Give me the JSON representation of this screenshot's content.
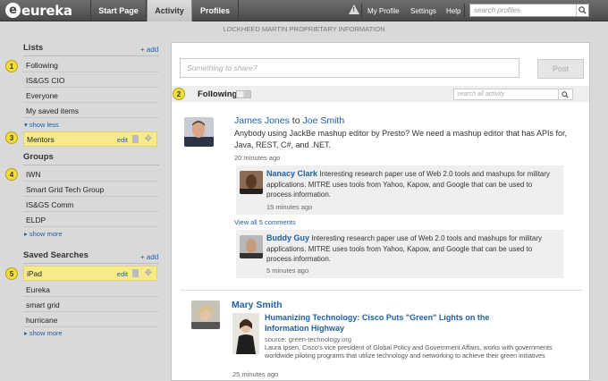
{
  "app": {
    "logo_text": "eureka",
    "logo_letter": "e",
    "banner": "LOCKHEED MARTIN PROPRIETARY INFORMATION"
  },
  "nav": {
    "tabs": [
      "Start Page",
      "Activity",
      "Profiles"
    ],
    "my_profile": "My Profile",
    "settings": "Settings",
    "help": "Help",
    "search_placeholder": "search profiles"
  },
  "sidebar": {
    "lists": {
      "title": "Lists",
      "add": "+ add",
      "items": [
        "Following",
        "IS&GS CIO",
        "Everyone",
        "My saved items"
      ],
      "show_less": "show less",
      "highlighted": "Mentors",
      "edit": "edit"
    },
    "groups": {
      "title": "Groups",
      "items": [
        "IWN",
        "Smart Grid Tech Group",
        "IS&GS Comm",
        "ELDP"
      ],
      "show_more": "show more"
    },
    "saved_searches": {
      "title": "Saved Searches",
      "add": "+ add",
      "highlighted": "iPad",
      "edit": "edit",
      "items": [
        "Eureka",
        "smart grid",
        "hurricane"
      ],
      "show_more": "show more"
    },
    "callouts": [
      "1",
      "2",
      "3",
      "4",
      "5"
    ]
  },
  "main": {
    "share_placeholder": "Something to share?",
    "post_label": "Post",
    "following_label": "Following",
    "search_activity_placeholder": "search all activity",
    "activity1": {
      "author": "James Jones",
      "to_word": "to",
      "target": "Joe Smith",
      "text": "Anybody using JackBe mashup editor by Presto? We need a mashup editor that has APIs for, Java, REST, C#, and .NET.",
      "time": "20 minutes ago",
      "comments": [
        {
          "author": "Nanacy Clark",
          "text": "Interesting research paper use of Web 2.0 tools and mashups for military applications. MITRE uses tools from Yahoo, Kapow, and Google that can be used to process information.",
          "time": "15 minutes ago"
        },
        {
          "author": "Buddy Guy",
          "text": "Interesting research paper use of Web 2.0 tools and mashups for military applications. MITRE uses tools from Yahoo, Kapow, and Google that can be used to process information.",
          "time": "5 minutes ago"
        }
      ],
      "view_all": "View all 5 comments"
    },
    "activity2": {
      "author": "Mary Smith",
      "link_title": "Humanizing Technology: Cisco Puts \"Green\" Lights on the Information Highway",
      "source": "source: green-technology.org",
      "snippet": "Laura Ipsen, Cisco's vice president of Global Policy and Government Affairs, works with governments worldwide piloting programs that utilize technology and networking to achieve their green initiatives",
      "time": "25 minutes ago"
    }
  },
  "colors": {
    "topbar": "#4a4a4a",
    "link": "#1f5fa8",
    "highlight": "#f5eb8a",
    "callout": "#f3dd3a"
  }
}
